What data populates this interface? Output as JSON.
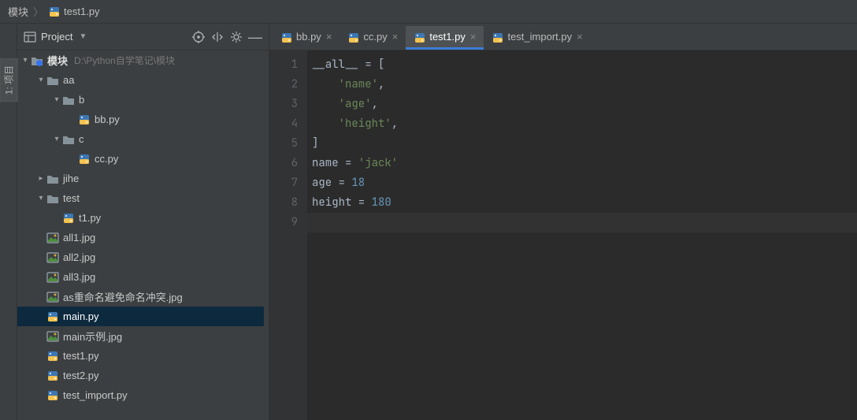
{
  "breadcrumb": {
    "root": "模块",
    "file": "test1.py"
  },
  "leftStripTab": "1: 项目",
  "projectPanel": {
    "title": "Project",
    "rootName": "模块",
    "rootPath": "D:\\Python自学笔记\\模块",
    "nodes": {
      "aa": "aa",
      "b": "b",
      "bb_py": "bb.py",
      "c": "c",
      "cc_py": "cc.py",
      "jihe": "jihe",
      "test": "test",
      "t1_py": "t1.py",
      "all1_jpg": "all1.jpg",
      "all2_jpg": "all2.jpg",
      "all3_jpg": "all3.jpg",
      "as_jpg": "as重命名避免命名冲突.jpg",
      "main_py": "main.py",
      "main_ex_jpg": "main示例.jpg",
      "test1_py": "test1.py",
      "test2_py": "test2.py",
      "test_import_py": "test_import.py"
    }
  },
  "editorTabs": [
    {
      "label": "bb.py",
      "active": false
    },
    {
      "label": "cc.py",
      "active": false
    },
    {
      "label": "test1.py",
      "active": true
    },
    {
      "label": "test_import.py",
      "active": false
    }
  ],
  "code": {
    "lines": [
      {
        "n": 1,
        "tokens": [
          [
            "all",
            "__all__"
          ],
          [
            "op",
            " = "
          ],
          [
            "br",
            "["
          ]
        ]
      },
      {
        "n": 2,
        "tokens": [
          [
            "pad",
            "    "
          ],
          [
            "str",
            "'name'"
          ],
          [
            "op",
            ","
          ]
        ]
      },
      {
        "n": 3,
        "tokens": [
          [
            "pad",
            "    "
          ],
          [
            "str",
            "'age'"
          ],
          [
            "op",
            ","
          ]
        ]
      },
      {
        "n": 4,
        "tokens": [
          [
            "pad",
            "    "
          ],
          [
            "str",
            "'height'"
          ],
          [
            "op",
            ","
          ]
        ]
      },
      {
        "n": 5,
        "tokens": [
          [
            "br",
            "]"
          ]
        ]
      },
      {
        "n": 6,
        "tokens": [
          [
            "id",
            "name"
          ],
          [
            "op",
            " = "
          ],
          [
            "str",
            "'jack'"
          ]
        ]
      },
      {
        "n": 7,
        "tokens": [
          [
            "id",
            "age"
          ],
          [
            "op",
            " = "
          ],
          [
            "num",
            "18"
          ]
        ]
      },
      {
        "n": 8,
        "tokens": [
          [
            "id",
            "height"
          ],
          [
            "op",
            " = "
          ],
          [
            "num",
            "180"
          ]
        ]
      },
      {
        "n": 9,
        "tokens": []
      }
    ],
    "caretLine": 9
  }
}
